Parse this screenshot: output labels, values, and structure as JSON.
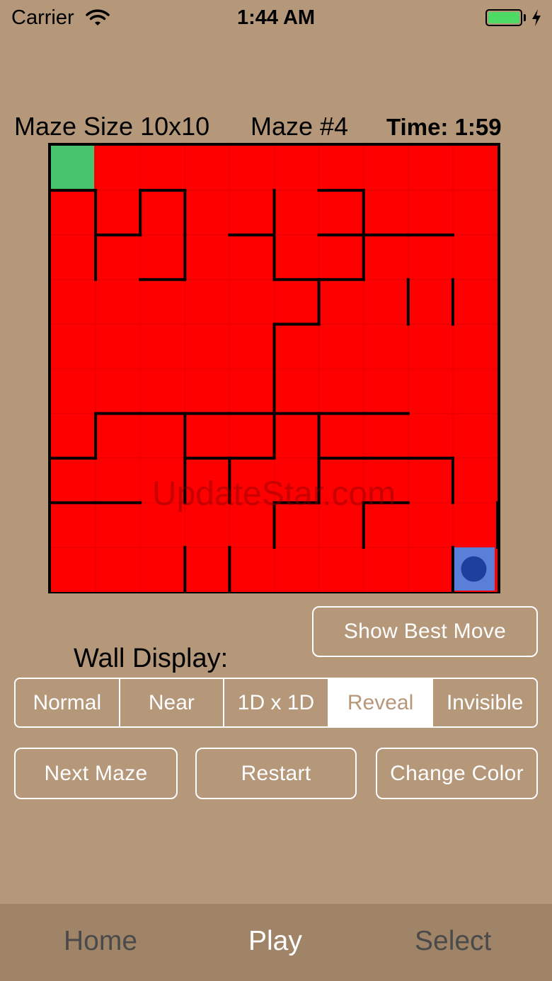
{
  "status_bar": {
    "carrier": "Carrier",
    "time": "1:44 AM",
    "battery_color": "#4cd964"
  },
  "info": {
    "maze_size": "Maze Size 10x10",
    "maze_number": "Maze #4",
    "timer": "Time: 1:59"
  },
  "maze": {
    "rows": 10,
    "cols": 10,
    "floor_color": "#ff0000",
    "start": {
      "row": 0,
      "col": 0,
      "color": "#48c46e"
    },
    "player": {
      "row": 9,
      "col": 9,
      "color": "#5a7fd8",
      "dot_color": "#1f3f9e"
    },
    "watermark": "UpdateStar.com",
    "h_walls": [
      [
        1,
        0
      ],
      [
        1,
        2
      ],
      [
        1,
        6
      ],
      [
        2,
        1
      ],
      [
        2,
        6
      ],
      [
        2,
        4
      ],
      [
        2,
        7
      ],
      [
        2,
        8
      ],
      [
        3,
        2
      ],
      [
        3,
        5
      ],
      [
        3,
        6
      ],
      [
        4,
        5
      ],
      [
        6,
        1
      ],
      [
        6,
        2
      ],
      [
        6,
        3
      ],
      [
        6,
        4
      ],
      [
        6,
        5
      ],
      [
        6,
        6
      ],
      [
        6,
        7
      ],
      [
        7,
        0
      ],
      [
        7,
        3
      ],
      [
        7,
        4
      ],
      [
        7,
        6
      ],
      [
        7,
        7
      ],
      [
        7,
        8
      ],
      [
        8,
        0
      ],
      [
        8,
        1
      ],
      [
        8,
        5
      ],
      [
        8,
        7
      ]
    ],
    "v_walls": [
      [
        1,
        1
      ],
      [
        1,
        2
      ],
      [
        1,
        3
      ],
      [
        1,
        5
      ],
      [
        1,
        7
      ],
      [
        2,
        1
      ],
      [
        2,
        3
      ],
      [
        2,
        5
      ],
      [
        2,
        7
      ],
      [
        3,
        6
      ],
      [
        3,
        8
      ],
      [
        3,
        9
      ],
      [
        4,
        5
      ],
      [
        5,
        5
      ],
      [
        6,
        1
      ],
      [
        6,
        3
      ],
      [
        6,
        5
      ],
      [
        6,
        6
      ],
      [
        7,
        3
      ],
      [
        7,
        4
      ],
      [
        7,
        6
      ],
      [
        7,
        9
      ],
      [
        8,
        5
      ],
      [
        8,
        7
      ],
      [
        8,
        10
      ],
      [
        9,
        3
      ],
      [
        9,
        4
      ],
      [
        9,
        9
      ]
    ]
  },
  "controls": {
    "show_best_move": "Show Best Move",
    "wall_display_label": "Wall Display:",
    "wall_display_options": [
      "Normal",
      "Near",
      "1D x 1D",
      "Reveal",
      "Invisible"
    ],
    "wall_display_selected": "Reveal",
    "next_maze": "Next Maze",
    "restart": "Restart",
    "change_color": "Change Color"
  },
  "tabs": [
    {
      "label": "Home",
      "active": false
    },
    {
      "label": "Play",
      "active": true
    },
    {
      "label": "Select",
      "active": false
    }
  ]
}
